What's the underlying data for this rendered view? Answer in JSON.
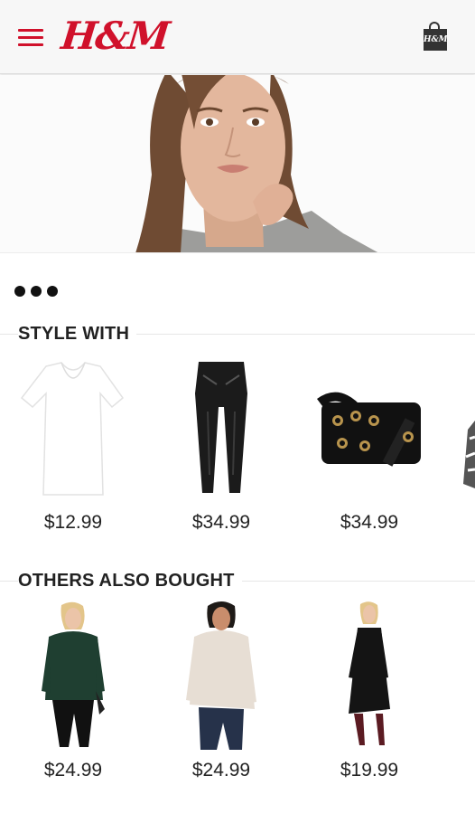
{
  "header": {
    "logo_text": "H&M",
    "bag_logo_text": "H&M",
    "menu_icon": "hamburger-menu-icon",
    "bag_icon": "shopping-bag-icon",
    "brand_color": "#d0112b"
  },
  "carousel": {
    "page_count": 3
  },
  "style_with": {
    "title": "STYLE WITH",
    "items": [
      {
        "price": "$12.99"
      },
      {
        "price": "$34.99"
      },
      {
        "price": "$34.99"
      }
    ]
  },
  "others_also_bought": {
    "title": "OTHERS ALSO BOUGHT",
    "items": [
      {
        "price": "$24.99"
      },
      {
        "price": "$24.99"
      },
      {
        "price": "$19.99"
      }
    ]
  }
}
